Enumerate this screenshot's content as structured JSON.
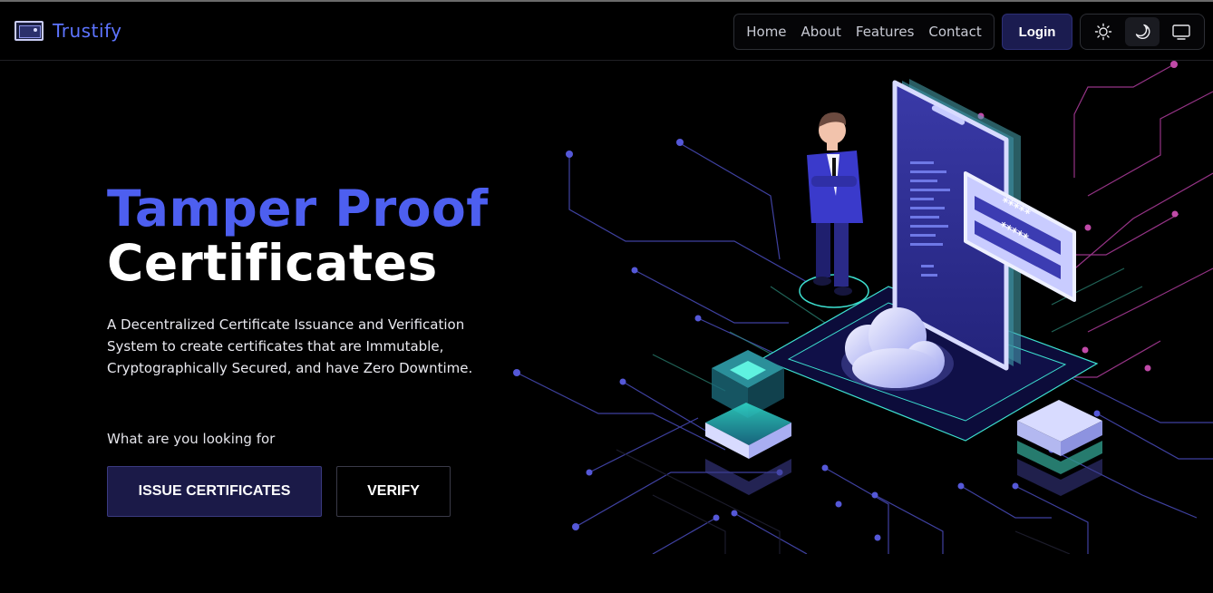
{
  "brand": {
    "name": "Trustify",
    "icon": "certificate-card-icon"
  },
  "nav": {
    "items": [
      "Home",
      "About",
      "Features",
      "Contact"
    ]
  },
  "login_label": "Login",
  "theme_switcher": {
    "options": [
      {
        "icon": "sun-icon",
        "active": false
      },
      {
        "icon": "moon-icon",
        "active": true
      },
      {
        "icon": "monitor-icon",
        "active": false
      }
    ]
  },
  "hero": {
    "title_line1": "Tamper Proof",
    "title_line2": "Certificates",
    "description": "A Decentralized Certificate Issuance and Verification System to create certificates that are Immutable, Cryptographically Secured, and have Zero Downtime.",
    "prompt": "What are you looking for",
    "issue_button": "ISSUE CERTIFICATES",
    "verify_button": "VERIFY"
  },
  "illustration": {
    "password_field_1": "*****",
    "password_field_2": "*****"
  },
  "colors": {
    "accent_blue": "#4d5ff0",
    "brand_blue": "#5d74ff",
    "login_bg": "#1b1c50",
    "background": "#000000"
  }
}
